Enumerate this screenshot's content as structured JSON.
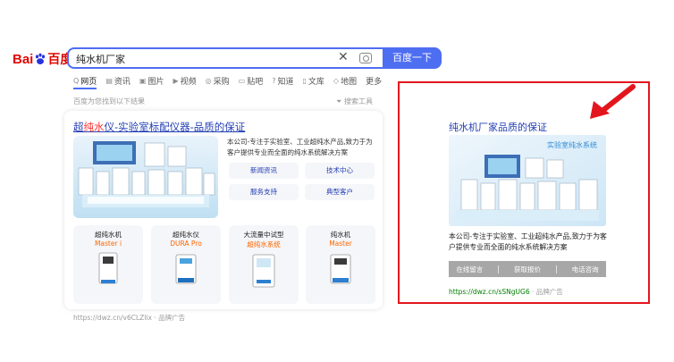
{
  "logo": {
    "left_text": "Bai",
    "right_text": "百度"
  },
  "search": {
    "query": "纯水机厂家",
    "button": "百度一下"
  },
  "tabs": [
    {
      "icon": "Q",
      "label": "网页"
    },
    {
      "icon": "▤",
      "label": "资讯"
    },
    {
      "icon": "▣",
      "label": "图片"
    },
    {
      "icon": "▶",
      "label": "视频"
    },
    {
      "icon": "◎",
      "label": "采购"
    },
    {
      "icon": "▭",
      "label": "贴吧"
    },
    {
      "icon": "?",
      "label": "知道"
    },
    {
      "icon": "▯",
      "label": "文库"
    },
    {
      "icon": "◇",
      "label": "地图"
    },
    {
      "icon": "",
      "label": "更多"
    }
  ],
  "result_count": "百度为您找到以下结果",
  "tools": "搜索工具",
  "main_ad": {
    "title_pre": "超",
    "title_hl": "纯水",
    "title_post": "仪-实验室标配仪器-品质的保证",
    "description": "本公司-专注于实验室、工业超纯水产品,致力于为客户提供专业而全面的纯水系统解决方案",
    "buttons": [
      "新闻资讯",
      "技术中心",
      "服务支持",
      "典型客户"
    ],
    "products": [
      {
        "name": "超纯水机",
        "sub": "Master i"
      },
      {
        "name": "超纯水仪",
        "sub": "DURA Pro"
      },
      {
        "name": "大流量中试型",
        "sub": "超纯水系统"
      },
      {
        "name": "纯水机",
        "sub": "Master"
      }
    ],
    "url": "https://dwz.cn/v6CLZIix · 品牌广告"
  },
  "side_ad": {
    "title": "纯水机厂家品质的保证",
    "image_caption": "实验室纯水系统",
    "description": "本公司-专注于实验室、工业超纯水产品,致力于为客户提供专业而全面的纯水系统解决方案",
    "actions": [
      "在线留言",
      "获取报价",
      "电话咨询"
    ],
    "url": "https://dwz.cn/sSNgUG6",
    "ad_label": "· 品牌广告"
  },
  "colors": {
    "brand_blue": "#4e6ef2",
    "link": "#2440b3",
    "highlight": "#e3161d"
  }
}
